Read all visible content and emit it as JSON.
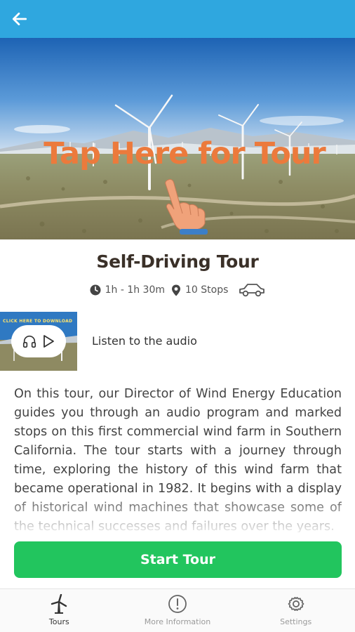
{
  "header": {
    "back_icon": "arrow-left-icon",
    "bar_color": "#2fa7df"
  },
  "hero": {
    "overlay_text": "Tap Here for Tour",
    "overlay_color": "#ec7a3c",
    "hand_icon": "pointing-hand-icon"
  },
  "tour": {
    "title": "Self-Driving Tour",
    "duration": "1h - 1h 30m",
    "stops": "10 Stops",
    "duration_icon": "clock-icon",
    "stops_icon": "map-pin-icon",
    "vehicle_icon": "car-icon"
  },
  "audio": {
    "thumb_banner": "CLICK HERE TO DOWNLOAD",
    "label": "Listen to the audio",
    "headphones_icon": "headphones-icon",
    "play_icon": "play-icon"
  },
  "description": "On this tour, our Director of Wind Energy Education guides you through an audio program and marked stops on this first commercial wind farm in Southern California. The tour starts with a journey through time, exploring the history of this wind farm that became operational in 1982. It begins with a display of historical wind machines that showcase some of the technical successes and failures over the years.",
  "start_button": {
    "label": "Start Tour",
    "color": "#22c55e"
  },
  "bottom_nav": {
    "tours": "Tours",
    "more_info": "More Information",
    "settings": "Settings"
  }
}
